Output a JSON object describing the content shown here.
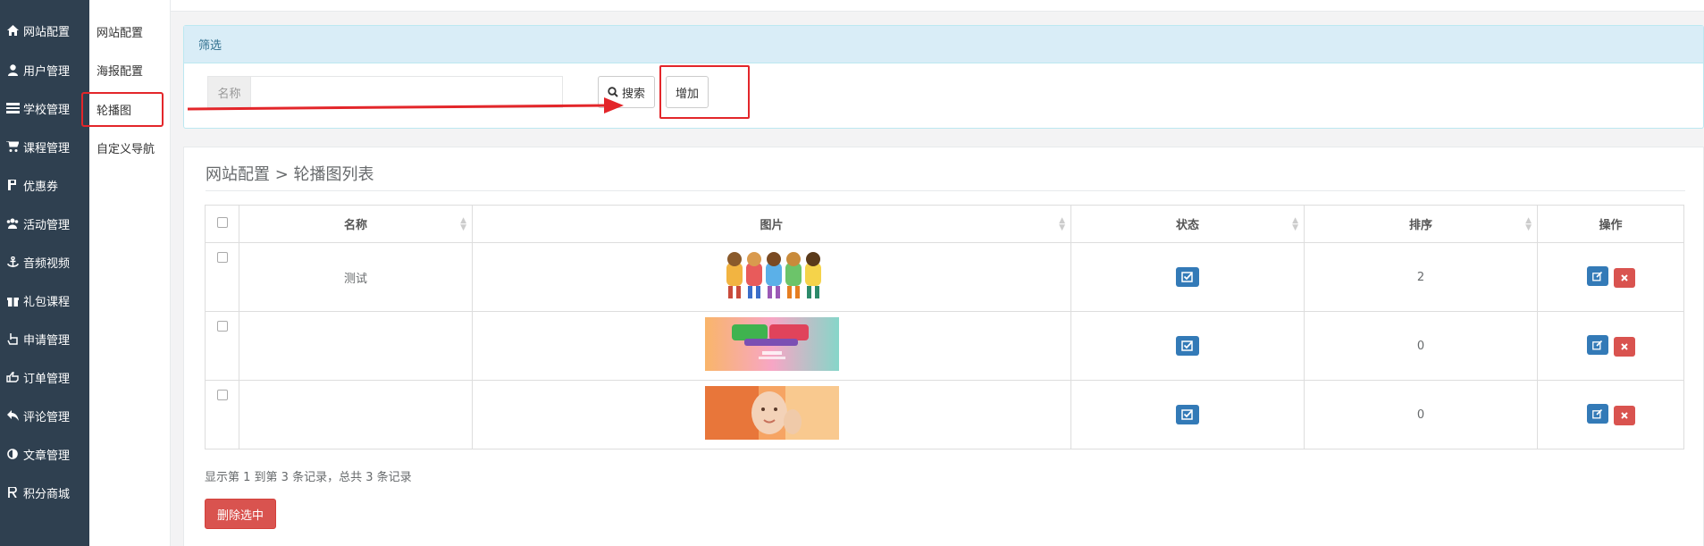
{
  "sidebar": {
    "items": [
      {
        "label": "网站配置",
        "icon": "home-icon"
      },
      {
        "label": "用户管理",
        "icon": "user-icon"
      },
      {
        "label": "学校管理",
        "icon": "building-icon"
      },
      {
        "label": "课程管理",
        "icon": "cart-icon"
      },
      {
        "label": "优惠券",
        "icon": "coupon-icon"
      },
      {
        "label": "活动管理",
        "icon": "people-icon"
      },
      {
        "label": "音频视频",
        "icon": "anchor-icon"
      },
      {
        "label": "礼包课程",
        "icon": "gift-icon"
      },
      {
        "label": "申请管理",
        "icon": "hand-icon"
      },
      {
        "label": "订单管理",
        "icon": "thumb-icon"
      },
      {
        "label": "评论管理",
        "icon": "reply-icon"
      },
      {
        "label": "文章管理",
        "icon": "contrast-icon"
      },
      {
        "label": "积分商城",
        "icon": "points-icon"
      }
    ]
  },
  "submenu": {
    "items": [
      {
        "label": "网站配置"
      },
      {
        "label": "海报配置"
      },
      {
        "label": "轮播图"
      },
      {
        "label": "自定义导航"
      }
    ]
  },
  "filter": {
    "header": "筛选",
    "name_addon": "名称",
    "name_value": "",
    "search_label": "搜索",
    "add_label": "增加"
  },
  "list": {
    "title": "网站配置 > 轮播图列表",
    "columns": [
      "名称",
      "图片",
      "状态",
      "排序",
      "操作"
    ],
    "rows": [
      {
        "name": "测试",
        "order": "2",
        "image": "kids-icon"
      },
      {
        "name": "",
        "order": "0",
        "image": "banner-icon"
      },
      {
        "name": "",
        "order": "0",
        "image": "baby-photo-icon"
      }
    ],
    "pager_info": "显示第 1 到第 3 条记录，总共 3 条记录",
    "delete_selected": "删除选中"
  },
  "colors": {
    "sidebar_bg": "#2f4050",
    "highlight_red": "#e3262a",
    "primary_blue": "#337ab7",
    "danger_red": "#d9534f"
  }
}
